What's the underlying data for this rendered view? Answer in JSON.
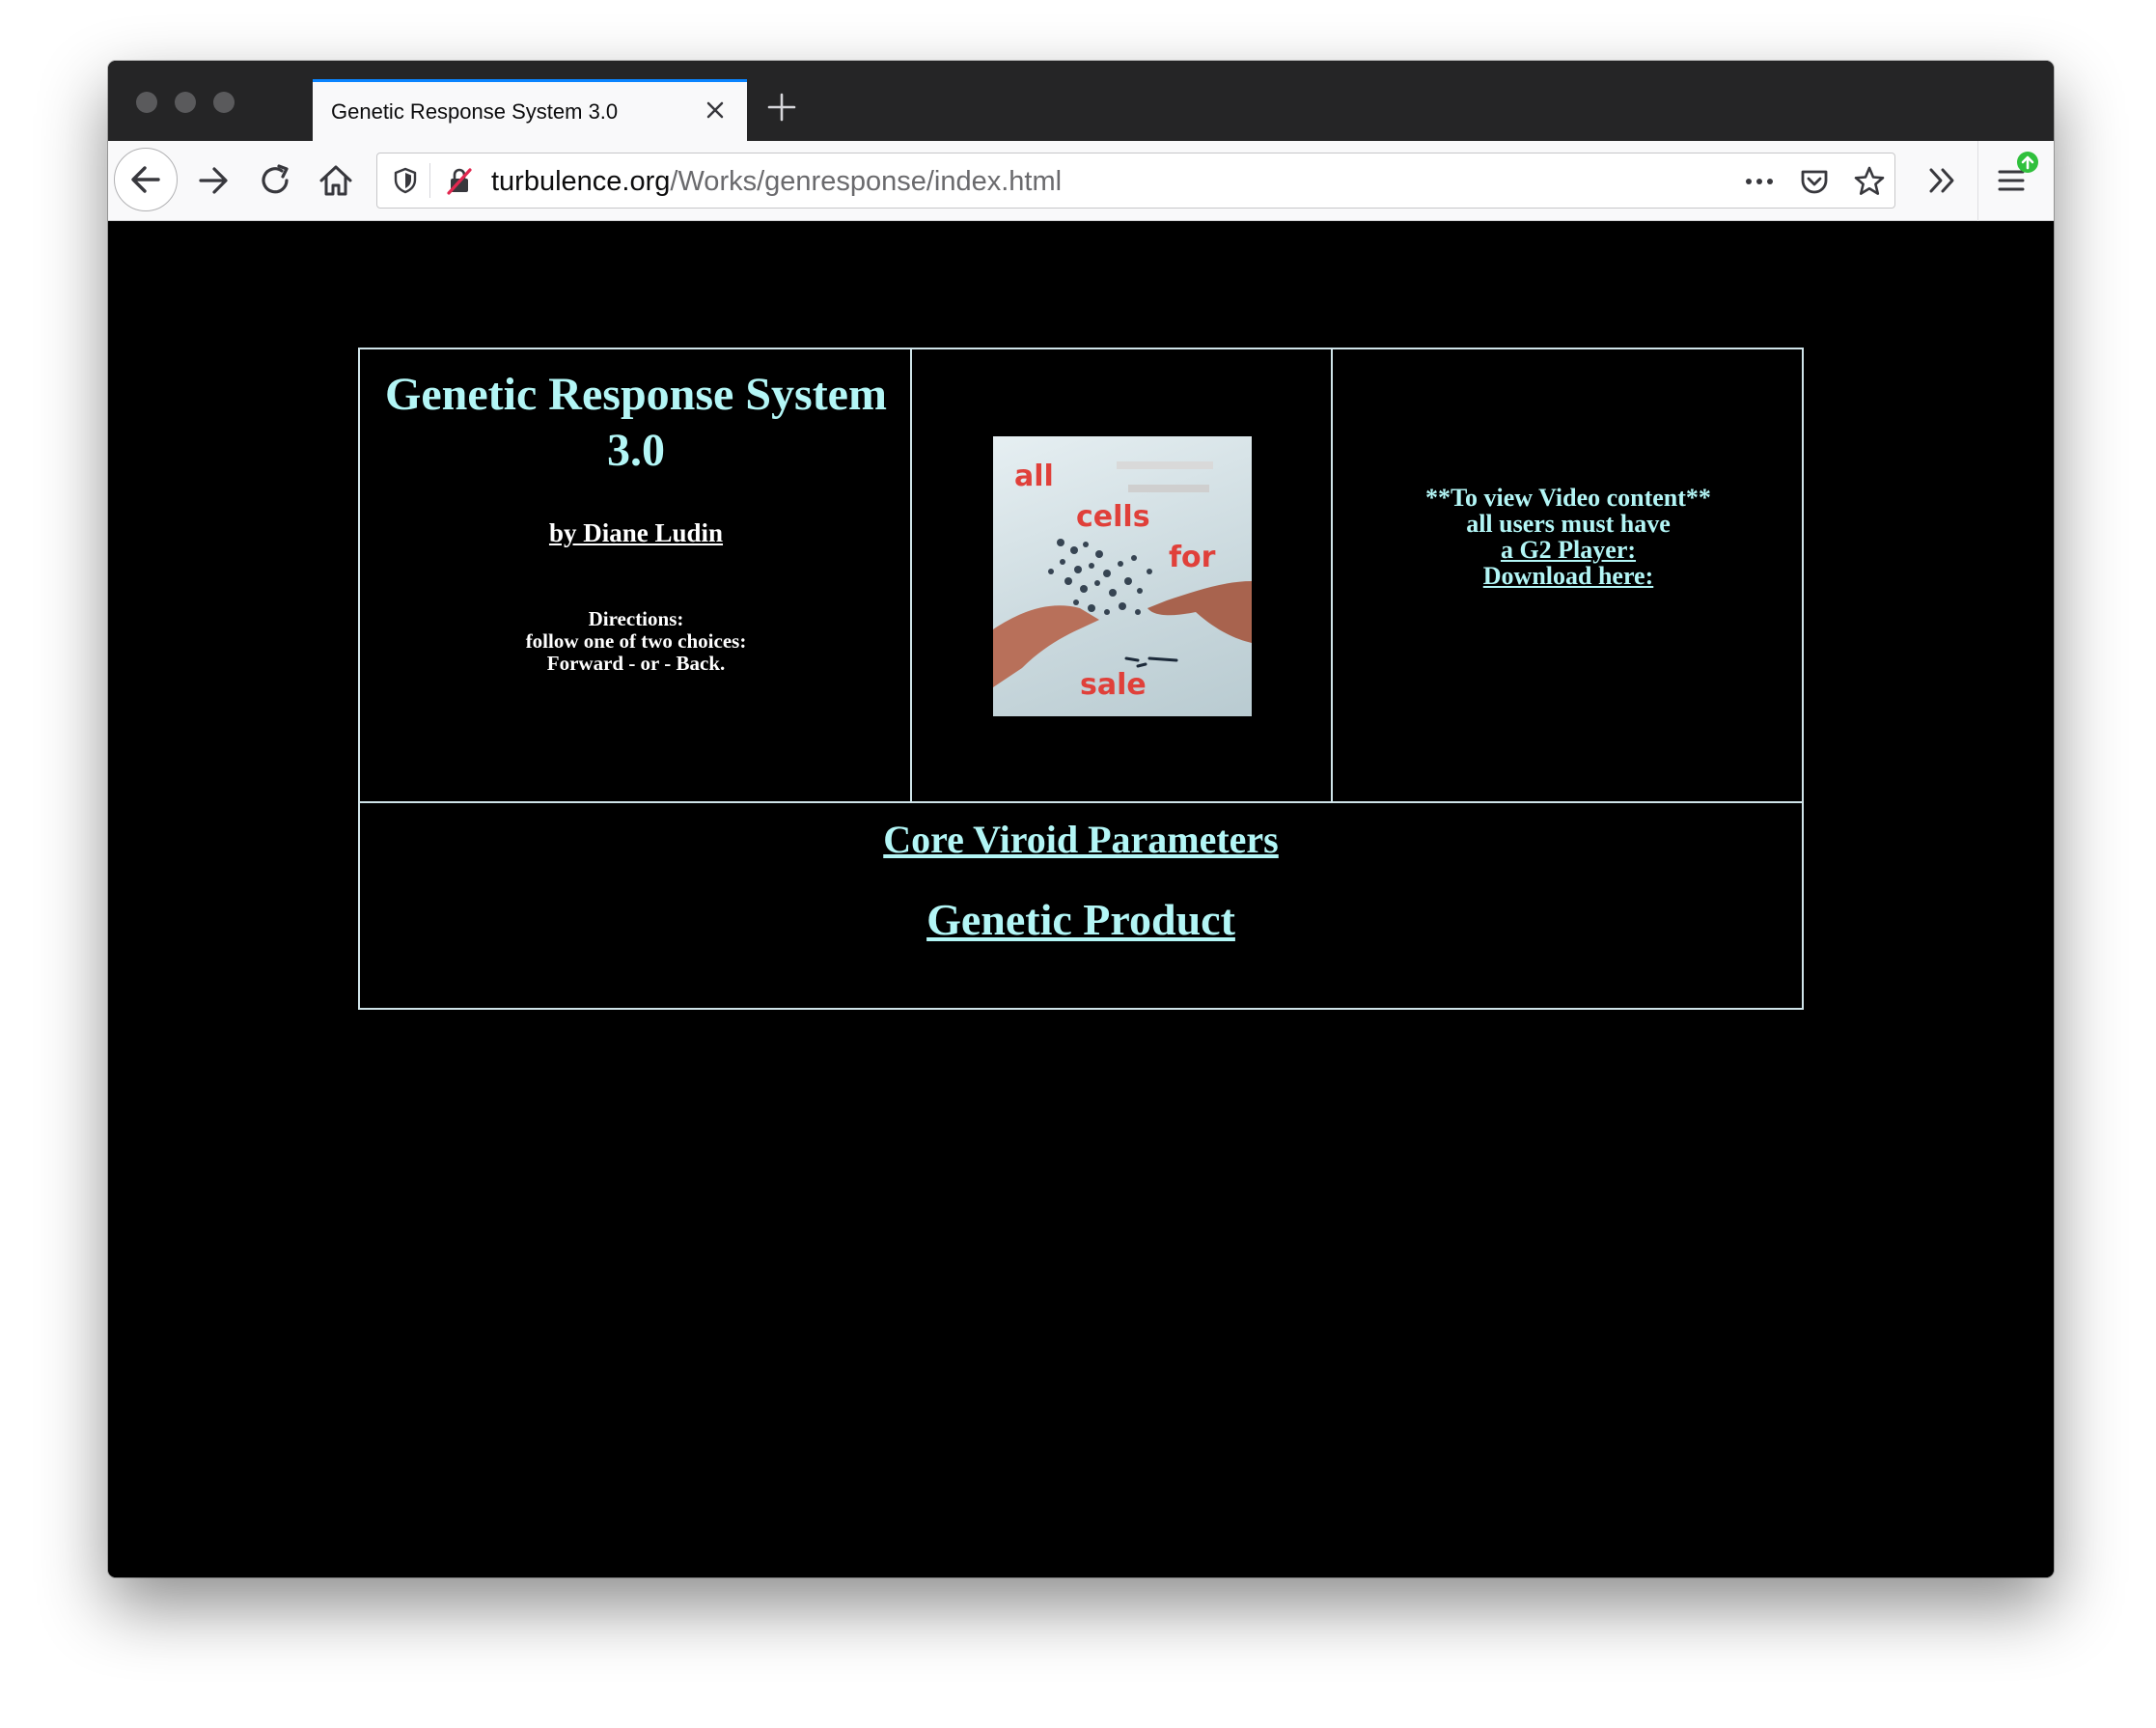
{
  "browser": {
    "tab_title": "Genetic Response System 3.0",
    "url_domain": "turbulence.org",
    "url_path": "/Works/genresponse/index.html"
  },
  "page": {
    "title": "Genetic Response System 3.0",
    "byline": "by Diane Ludin",
    "directions": {
      "line1": "Directions:",
      "line2": "follow one of two choices:",
      "line3": "Forward - or - Back."
    },
    "artwork": {
      "word1": "all",
      "word2": "cells",
      "word3": "for",
      "word4": "sale"
    },
    "video_note": {
      "line1": "**To view Video content**",
      "line2": "all users must have",
      "link1": "a G2 Player:",
      "link2": "Download here:"
    },
    "links": {
      "core": "Core Viroid Parameters",
      "product": "Genetic Product"
    }
  },
  "colors": {
    "page_bg": "#000000",
    "link_cyan": "#b3f6f6",
    "tab_accent": "#0a84ff"
  }
}
